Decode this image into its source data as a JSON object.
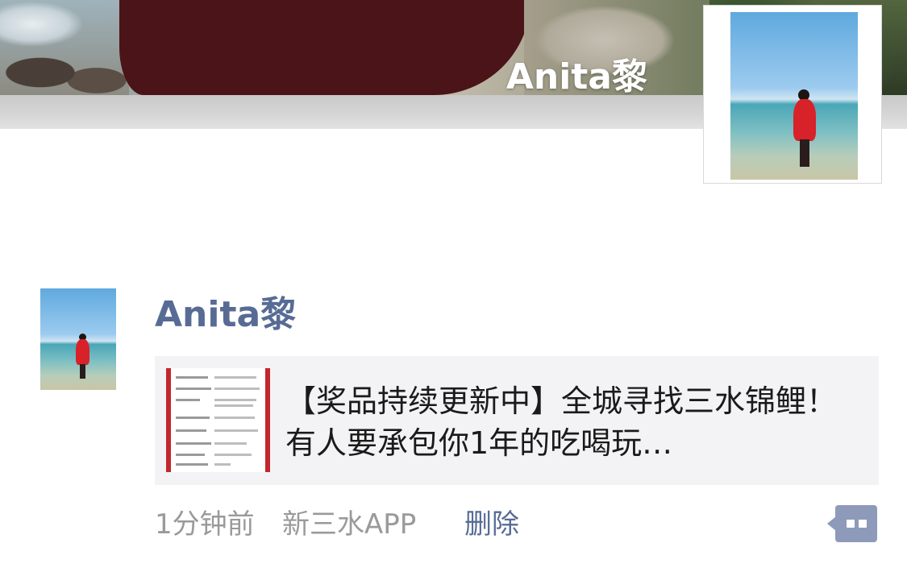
{
  "profile": {
    "cover_name": "Anita黎"
  },
  "moment": {
    "author": "Anita黎",
    "link": {
      "title": "【奖品持续更新中】全城寻找三水锦鲤！有人要承包你1年的吃喝玩…"
    },
    "meta": {
      "time": "1分钟前",
      "source": "新三水APP",
      "delete_label": "删除"
    }
  },
  "colors": {
    "link_blue": "#576b95",
    "meta_gray": "#9a9a9a",
    "card_bg": "#f3f3f5",
    "comment_button": "#8e9ab9"
  },
  "icons": {
    "comment": "comment-bubble-icon"
  }
}
